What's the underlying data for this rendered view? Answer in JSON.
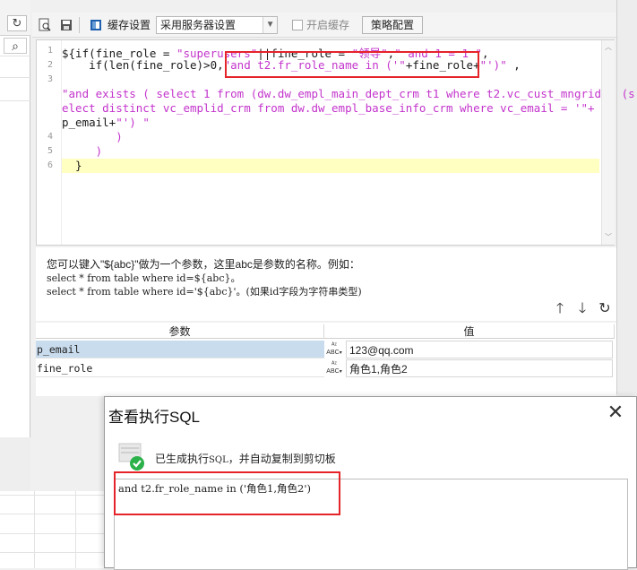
{
  "toolbar": {
    "cache_label": "缓存设置",
    "cache_value": "采用服务器设置",
    "enable_cache_label": "开启缓存",
    "strategy_button": "策略配置"
  },
  "editor": {
    "line_numbers": [
      "1",
      "2",
      "3",
      "",
      "",
      "4",
      "5",
      "6"
    ],
    "lines": {
      "l1_pre": "${if(fine_role = ",
      "l1_s1": "\"superusers\"",
      "l1_mid": "||fine_role = ",
      "l1_s2": "\"领导\"",
      "l1_tail": ",",
      "l1_s3": "\" and 1 = 1 \"",
      "l1_end": ",",
      "l2_pre": "    if(len(fine_role)>0,",
      "l2_s1": "\"and t2.fr_role_name in ('\"",
      "l2_mid": "+fine_role+",
      "l2_s2": "\"')\"",
      "l2_end": " ,",
      "l3a": "\"and exists ( select 1 from (dw.dw_empl_main_dept_crm t1 where t2.vc_cust_mngrid = (s",
      "l3b": "elect distinct vc_emplid_crm from dw.dw_empl_base_info_crm where vc_email = '\"+",
      "l3c_pre": "p_email+",
      "l3c_s": "\"') \"",
      "l4": "        )",
      "l5": "     )",
      "l6": "  }"
    }
  },
  "hint": {
    "line1": "您可以键入\"${abc}\"做为一个参数，这里abc是参数的名称。例如：",
    "line2_a": "select * from table where id=${abc}",
    "line2_b": "。",
    "line3_a": "select * from table where id='${abc}'",
    "line3_b": "。(如果id字段为字符串类型)"
  },
  "params": {
    "col_param": "参数",
    "col_value": "值",
    "type_glyph": "ᴬᶻ\nABC",
    "rows": [
      {
        "name": "p_email",
        "value": "123@qq.com"
      },
      {
        "name": "fine_role",
        "value": "角色1,角色2"
      }
    ]
  },
  "dialog": {
    "title": "查看执行SQL",
    "close": "✕",
    "message_a": "已生成执行",
    "message_sql": "SQL",
    "message_b": "，并自动复制到剪切板",
    "sql_text": "and t2.fr_role_name in ('角色1,角色2')"
  },
  "colors": {
    "string": "#c334cc",
    "highlight_line": "#ffffc2",
    "annotation_red": "#e5242a",
    "selected_row": "#c9dced"
  },
  "icons": {
    "refresh": "↻",
    "search": "⌕",
    "up": "🡑",
    "down": "🡓"
  }
}
